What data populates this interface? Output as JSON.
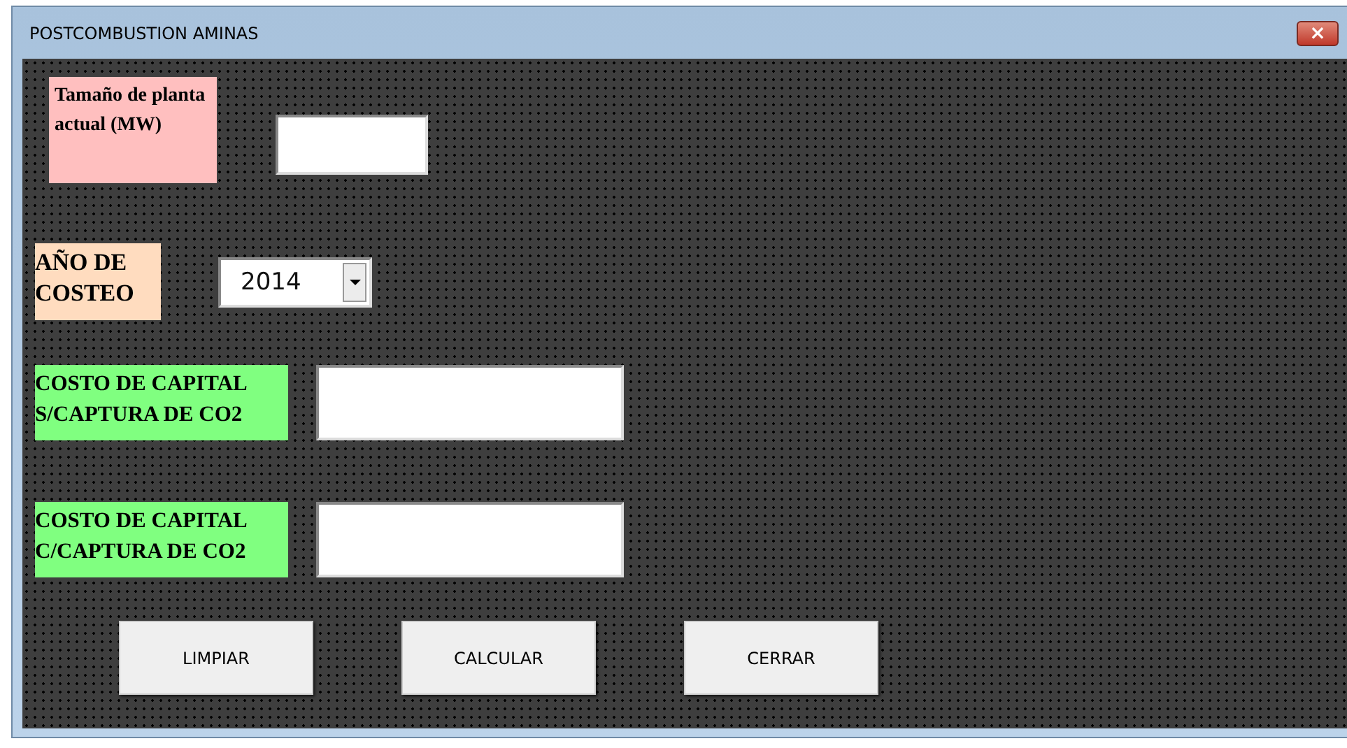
{
  "window": {
    "title": "POSTCOMBUSTION AMINAS",
    "close": "×"
  },
  "rows": [
    {
      "kind": "text",
      "label": "Tamaño de planta actual (MW)",
      "color": "#ffbfbf",
      "value": ""
    },
    {
      "kind": "combo",
      "label": "AÑO DE COSTEO",
      "color": "#ffdcbf",
      "value": "2014"
    },
    {
      "kind": "text",
      "label": "COSTO DE CAPITAL S/CAPTURA DE CO2",
      "color": "#80ff80",
      "value": ""
    },
    {
      "kind": "text",
      "label": "COSTO DE CAPITAL C/CAPTURA DE CO2",
      "color": "#80ff80",
      "value": ""
    }
  ],
  "buttons": [
    "LIMPIAR",
    "CALCULAR",
    "CERRAR"
  ]
}
